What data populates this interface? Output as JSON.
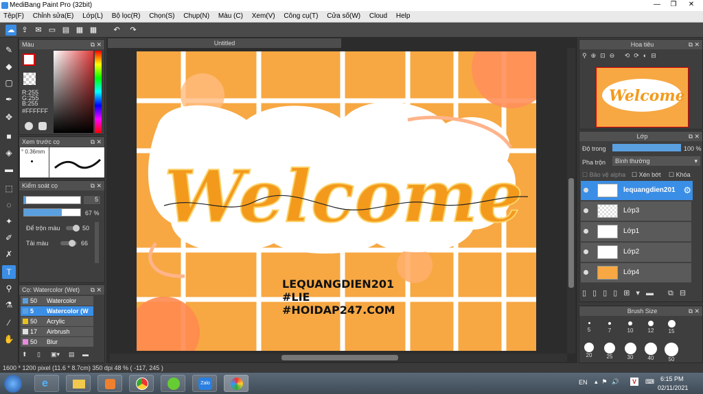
{
  "window": {
    "title": "MediBang Paint Pro (32bit)",
    "minimize": "—",
    "restore": "❐",
    "close": "✕"
  },
  "menu": [
    "Tệp(F)",
    "Chỉnh sửa(E)",
    "Lớp(L)",
    "Bộ lọc(R)",
    "Chọn(S)",
    "Chụp(N)",
    "Màu (C)",
    "Xem(V)",
    "Công cụ(T)",
    "Cửa số(W)",
    "Cloud",
    "Help"
  ],
  "color_panel": {
    "title": "Màu",
    "r": "R:255",
    "g": "G:255",
    "b": "B:255",
    "hex": "#FFFFFF"
  },
  "brush_preview": {
    "title": "Xem trước cọ",
    "size": "0.36mm"
  },
  "brush_control": {
    "title": "Kiểm soát cọ",
    "size_value": "5",
    "opacity_value": "67 %",
    "blend_label": "Để trộn màu",
    "blend_value": "50",
    "amount_label": "Tải màu",
    "amount_value": "66"
  },
  "brush_list": {
    "title": "Cọ: Watercolor (Wet)",
    "items": [
      {
        "num": "50",
        "name": "Watercolor",
        "color": "#5aa0e0"
      },
      {
        "num": "5",
        "name": "Watercolor (W",
        "color": "#5aa0e0"
      },
      {
        "num": "50",
        "name": "Acrylic",
        "color": "#e6c21e"
      },
      {
        "num": "17",
        "name": "Airbrush",
        "color": "#e0e0e0"
      },
      {
        "num": "50",
        "name": "Blur",
        "color": "#e88be0"
      }
    ]
  },
  "canvas": {
    "tab": "Untitled",
    "artwork": {
      "welcome": "Welcome",
      "line1": "LEQUANGDIEN201",
      "line2": "#LIE",
      "line3": "#HOIDAP247.COM"
    }
  },
  "navigator": {
    "title": "Hoa tiêu"
  },
  "layers": {
    "title": "Lớp",
    "opacity_label": "Độ trong",
    "opacity_value": "100 %",
    "opacity": 1.0,
    "blend_label": "Pha trộn",
    "blend_value": "Bình thường",
    "protect_alpha": "Bảo vệ alpha",
    "clip": "Xén bớt",
    "lock": "Khóa",
    "items": [
      {
        "name": "lequangdien201",
        "selected": true
      },
      {
        "name": "Lớp3"
      },
      {
        "name": "Lớp1"
      },
      {
        "name": "Lớp2"
      },
      {
        "name": "Lớp4"
      }
    ]
  },
  "brush_size": {
    "title": "Brush Size",
    "sizes": [
      "5",
      "7",
      "10",
      "12",
      "15",
      "20",
      "25",
      "30",
      "40",
      "50"
    ]
  },
  "status": {
    "text": "1600 * 1200 pixel   (11.6 * 8.7cm)   350 dpi   48 %   ( -117, 245 )"
  },
  "taskbar": {
    "lang": "EN",
    "time": "6:15 PM",
    "date": "02/11/2021"
  }
}
